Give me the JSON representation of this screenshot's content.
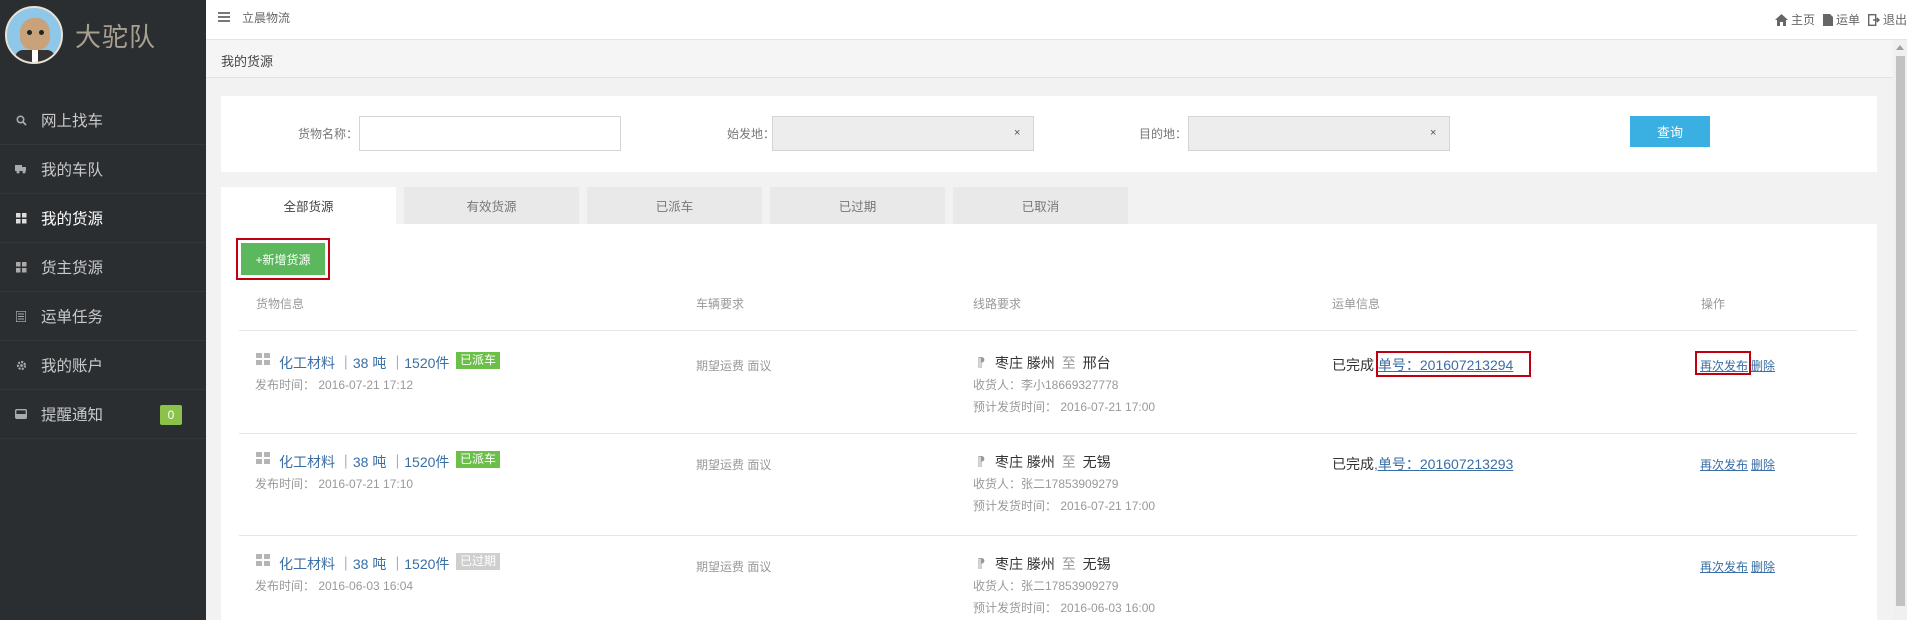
{
  "app": {
    "brand_name": "大驼队"
  },
  "sidebar": {
    "items": [
      {
        "label": "网上找车",
        "icon": "search-icon"
      },
      {
        "label": "我的车队",
        "icon": "truck-icon"
      },
      {
        "label": "我的货源",
        "icon": "cubes-icon",
        "active": true
      },
      {
        "label": "货主货源",
        "icon": "cubes-icon"
      },
      {
        "label": "运单任务",
        "icon": "list-icon"
      },
      {
        "label": "我的账户",
        "icon": "gear-icon"
      },
      {
        "label": "提醒通知",
        "icon": "inbox-icon",
        "badge": "0"
      }
    ]
  },
  "topbar": {
    "title": "立晨物流",
    "links": [
      {
        "label": "主页",
        "icon": "home-icon"
      },
      {
        "label": "运单",
        "icon": "file-icon"
      },
      {
        "label": "退出",
        "icon": "logout-icon"
      }
    ]
  },
  "page": {
    "title": "我的货源"
  },
  "search": {
    "cargo_label": "货物名称：",
    "cargo_value": "",
    "origin_label": "始发地：",
    "origin_value": "",
    "dest_label": "目的地：",
    "dest_value": "",
    "clear_symbol": "×",
    "query_label": "查询"
  },
  "tabs": [
    "全部货源",
    "有效货源",
    "已派车",
    "已过期",
    "已取消"
  ],
  "list": {
    "add_label": "+新增货源",
    "columns": [
      "货物信息",
      "车辆要求",
      "线路要求",
      "运单信息",
      "操作"
    ],
    "rows": [
      {
        "cargo": "化工材料 ｜38 吨 ｜1520件",
        "status": "已派车",
        "status_type": "dispatched",
        "publish_time": "发布时间： 2016-07-21 17:12",
        "vehicle": "期望运费 面议",
        "from": "枣庄 滕州",
        "to_word": "至",
        "to": "邢台",
        "receiver": "收货人：李小18669327778",
        "ship_time": "预计发货时间： 2016-07-21 17:00",
        "waybill_status": "已完成",
        "waybill_no": "单号：201607213294",
        "op_republish": "再次发布",
        "op_delete": "删除"
      },
      {
        "cargo": "化工材料 ｜38 吨 ｜1520件",
        "status": "已派车",
        "status_type": "dispatched",
        "publish_time": "发布时间： 2016-07-21 17:10",
        "vehicle": "期望运费 面议",
        "from": "枣庄 滕州",
        "to_word": "至",
        "to": "无锡",
        "receiver": "收货人：张二17853909279",
        "ship_time": "预计发货时间： 2016-07-21 17:00",
        "waybill_status": "已完成",
        "waybill_no": ",单号：201607213293",
        "op_republish": "再次发布",
        "op_delete": "删除"
      },
      {
        "cargo": "化工材料 ｜38 吨 ｜1520件",
        "status": "已过期",
        "status_type": "expired",
        "publish_time": "发布时间： 2016-06-03 16:04",
        "vehicle": "期望运费 面议",
        "from": "枣庄 滕州",
        "to_word": "至",
        "to": "无锡",
        "receiver": "收货人：张二17853909279",
        "ship_time": "预计发货时间： 2016-06-03 16:00",
        "waybill_status": "",
        "waybill_no": "",
        "op_republish": "再次发布",
        "op_delete": "删除"
      }
    ]
  },
  "colors": {
    "sidebar_bg": "#2b2e31",
    "accent_blue": "#3ab0e2",
    "add_green": "#5cb85c",
    "status_green": "#6cc04a",
    "highlight_red": "#c0000f",
    "link_blue": "#3a6ea5"
  }
}
